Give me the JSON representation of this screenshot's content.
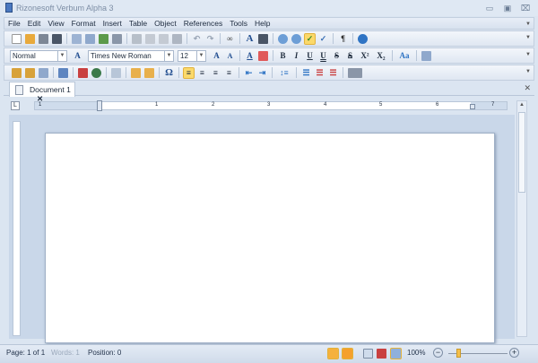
{
  "window": {
    "title": "Rizonesoft Verbum Alpha 3",
    "minimize": "▭",
    "restore": "▣",
    "close": "⌧"
  },
  "menu": [
    "File",
    "Edit",
    "View",
    "Format",
    "Insert",
    "Table",
    "Object",
    "References",
    "Tools",
    "Help"
  ],
  "format_bar": {
    "style": "Normal",
    "font": "Times New Roman",
    "size": "12",
    "bold": "B",
    "italic": "I",
    "underline": "U",
    "double_underline": "U",
    "strike": "S",
    "double_strike": "S",
    "superscript": "X²",
    "subscript": "X₂",
    "change_case": "Aa",
    "grow": "A",
    "shrink": "A",
    "font_color": "A"
  },
  "toolbar": {
    "find": "A",
    "symbol": "Ω",
    "pilcrow": "¶"
  },
  "tab": {
    "label": "Document 1",
    "close": "✕"
  },
  "ruler": [
    "1",
    "1",
    "2",
    "3",
    "4",
    "5",
    "6",
    "7"
  ],
  "status": {
    "page": "Page: 1 of 1",
    "words": "Words: 1",
    "position": "Position: 0",
    "zoom": "100%",
    "zoom_level_percent": 100,
    "zoom_out": "−",
    "zoom_in": "+"
  }
}
